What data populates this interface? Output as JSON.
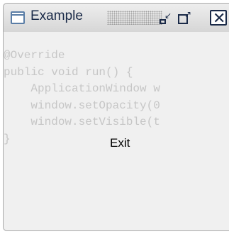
{
  "window": {
    "title": "Example",
    "buttons": {
      "minimize_icon": "minimize-icon",
      "maximize_icon": "maximize-icon",
      "close_icon": "close-icon"
    }
  },
  "code": {
    "lines": [
      "@Override",
      "public void run() {",
      "    ApplicationWindow w",
      "    window.setOpacity(0",
      "    window.setVisible(t",
      "}"
    ]
  },
  "exit_label": "Exit",
  "colors": {
    "code_text": "#c6c6c6",
    "title_text": "#1a2a48",
    "background": "#f0f0f0"
  }
}
